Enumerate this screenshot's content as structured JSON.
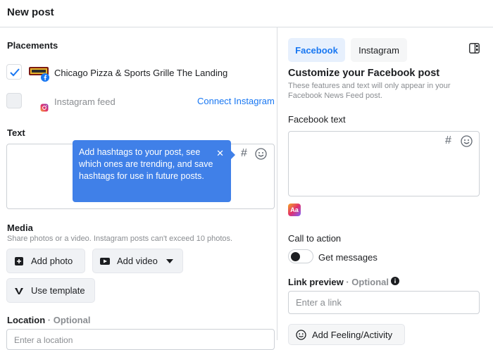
{
  "header": {
    "title": "New post"
  },
  "placements": {
    "title": "Placements",
    "facebook_page": "Chicago Pizza & Sports Grille The Landing",
    "instagram_feed": "Instagram feed",
    "connect_link": "Connect Instagram"
  },
  "text_section": {
    "title": "Text",
    "hashtag_glyph": "#",
    "tooltip": "Add hashtags to your post, see which ones are trending, and save hashtags for use in future posts.",
    "tooltip_close": "✕"
  },
  "media": {
    "title": "Media",
    "subtitle": "Share photos or a video. Instagram posts can't exceed 10 photos.",
    "add_photo": "Add photo",
    "add_video": "Add video",
    "use_template": "Use template"
  },
  "location": {
    "title": "Location",
    "optional": " · Optional",
    "placeholder": "Enter a location"
  },
  "right": {
    "tabs": [
      {
        "label": "Facebook"
      },
      {
        "label": "Instagram"
      }
    ],
    "customize_title": "Customize your Facebook post",
    "customize_sub": "These features and text will only appear in your Facebook News Feed post.",
    "fb_text_label": "Facebook text",
    "hashtag_glyph": "#",
    "cta_title": "Call to action",
    "cta_toggle_label": "Get messages",
    "link_preview_title": "Link preview",
    "link_preview_optional": " · Optional",
    "link_placeholder": "Enter a link",
    "feeling_button": "Add Feeling/Activity",
    "aa_badge": "Aa"
  },
  "colors": {
    "accent": "#1877f2",
    "tooltip": "#4080e8",
    "border": "#dadde1"
  },
  "icons": [
    "check-icon",
    "facebook-badge-icon",
    "instagram-icon",
    "hashtag-icon",
    "emoji-icon",
    "close-icon",
    "photo-icon",
    "video-icon",
    "caret-down-icon",
    "template-icon",
    "layout-toggle-icon",
    "info-icon",
    "feeling-icon",
    "text-style-icon"
  ]
}
